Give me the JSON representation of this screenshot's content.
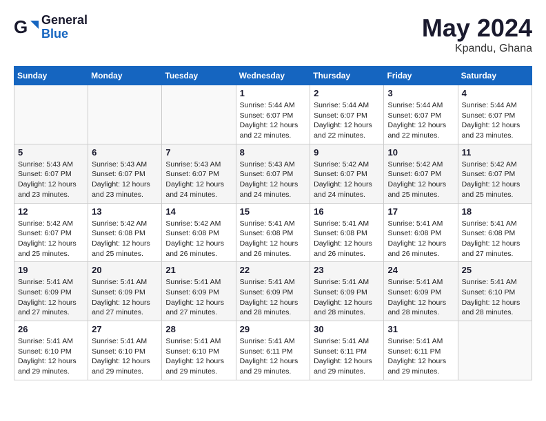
{
  "header": {
    "logo_general": "General",
    "logo_blue": "Blue",
    "month_year": "May 2024",
    "location": "Kpandu, Ghana"
  },
  "weekdays": [
    "Sunday",
    "Monday",
    "Tuesday",
    "Wednesday",
    "Thursday",
    "Friday",
    "Saturday"
  ],
  "weeks": [
    [
      {
        "day": "",
        "info": ""
      },
      {
        "day": "",
        "info": ""
      },
      {
        "day": "",
        "info": ""
      },
      {
        "day": "1",
        "info": "Sunrise: 5:44 AM\nSunset: 6:07 PM\nDaylight: 12 hours\nand 22 minutes."
      },
      {
        "day": "2",
        "info": "Sunrise: 5:44 AM\nSunset: 6:07 PM\nDaylight: 12 hours\nand 22 minutes."
      },
      {
        "day": "3",
        "info": "Sunrise: 5:44 AM\nSunset: 6:07 PM\nDaylight: 12 hours\nand 22 minutes."
      },
      {
        "day": "4",
        "info": "Sunrise: 5:44 AM\nSunset: 6:07 PM\nDaylight: 12 hours\nand 23 minutes."
      }
    ],
    [
      {
        "day": "5",
        "info": "Sunrise: 5:43 AM\nSunset: 6:07 PM\nDaylight: 12 hours\nand 23 minutes."
      },
      {
        "day": "6",
        "info": "Sunrise: 5:43 AM\nSunset: 6:07 PM\nDaylight: 12 hours\nand 23 minutes."
      },
      {
        "day": "7",
        "info": "Sunrise: 5:43 AM\nSunset: 6:07 PM\nDaylight: 12 hours\nand 24 minutes."
      },
      {
        "day": "8",
        "info": "Sunrise: 5:43 AM\nSunset: 6:07 PM\nDaylight: 12 hours\nand 24 minutes."
      },
      {
        "day": "9",
        "info": "Sunrise: 5:42 AM\nSunset: 6:07 PM\nDaylight: 12 hours\nand 24 minutes."
      },
      {
        "day": "10",
        "info": "Sunrise: 5:42 AM\nSunset: 6:07 PM\nDaylight: 12 hours\nand 25 minutes."
      },
      {
        "day": "11",
        "info": "Sunrise: 5:42 AM\nSunset: 6:07 PM\nDaylight: 12 hours\nand 25 minutes."
      }
    ],
    [
      {
        "day": "12",
        "info": "Sunrise: 5:42 AM\nSunset: 6:07 PM\nDaylight: 12 hours\nand 25 minutes."
      },
      {
        "day": "13",
        "info": "Sunrise: 5:42 AM\nSunset: 6:08 PM\nDaylight: 12 hours\nand 25 minutes."
      },
      {
        "day": "14",
        "info": "Sunrise: 5:42 AM\nSunset: 6:08 PM\nDaylight: 12 hours\nand 26 minutes."
      },
      {
        "day": "15",
        "info": "Sunrise: 5:41 AM\nSunset: 6:08 PM\nDaylight: 12 hours\nand 26 minutes."
      },
      {
        "day": "16",
        "info": "Sunrise: 5:41 AM\nSunset: 6:08 PM\nDaylight: 12 hours\nand 26 minutes."
      },
      {
        "day": "17",
        "info": "Sunrise: 5:41 AM\nSunset: 6:08 PM\nDaylight: 12 hours\nand 26 minutes."
      },
      {
        "day": "18",
        "info": "Sunrise: 5:41 AM\nSunset: 6:08 PM\nDaylight: 12 hours\nand 27 minutes."
      }
    ],
    [
      {
        "day": "19",
        "info": "Sunrise: 5:41 AM\nSunset: 6:09 PM\nDaylight: 12 hours\nand 27 minutes."
      },
      {
        "day": "20",
        "info": "Sunrise: 5:41 AM\nSunset: 6:09 PM\nDaylight: 12 hours\nand 27 minutes."
      },
      {
        "day": "21",
        "info": "Sunrise: 5:41 AM\nSunset: 6:09 PM\nDaylight: 12 hours\nand 27 minutes."
      },
      {
        "day": "22",
        "info": "Sunrise: 5:41 AM\nSunset: 6:09 PM\nDaylight: 12 hours\nand 28 minutes."
      },
      {
        "day": "23",
        "info": "Sunrise: 5:41 AM\nSunset: 6:09 PM\nDaylight: 12 hours\nand 28 minutes."
      },
      {
        "day": "24",
        "info": "Sunrise: 5:41 AM\nSunset: 6:09 PM\nDaylight: 12 hours\nand 28 minutes."
      },
      {
        "day": "25",
        "info": "Sunrise: 5:41 AM\nSunset: 6:10 PM\nDaylight: 12 hours\nand 28 minutes."
      }
    ],
    [
      {
        "day": "26",
        "info": "Sunrise: 5:41 AM\nSunset: 6:10 PM\nDaylight: 12 hours\nand 29 minutes."
      },
      {
        "day": "27",
        "info": "Sunrise: 5:41 AM\nSunset: 6:10 PM\nDaylight: 12 hours\nand 29 minutes."
      },
      {
        "day": "28",
        "info": "Sunrise: 5:41 AM\nSunset: 6:10 PM\nDaylight: 12 hours\nand 29 minutes."
      },
      {
        "day": "29",
        "info": "Sunrise: 5:41 AM\nSunset: 6:11 PM\nDaylight: 12 hours\nand 29 minutes."
      },
      {
        "day": "30",
        "info": "Sunrise: 5:41 AM\nSunset: 6:11 PM\nDaylight: 12 hours\nand 29 minutes."
      },
      {
        "day": "31",
        "info": "Sunrise: 5:41 AM\nSunset: 6:11 PM\nDaylight: 12 hours\nand 29 minutes."
      },
      {
        "day": "",
        "info": ""
      }
    ]
  ]
}
